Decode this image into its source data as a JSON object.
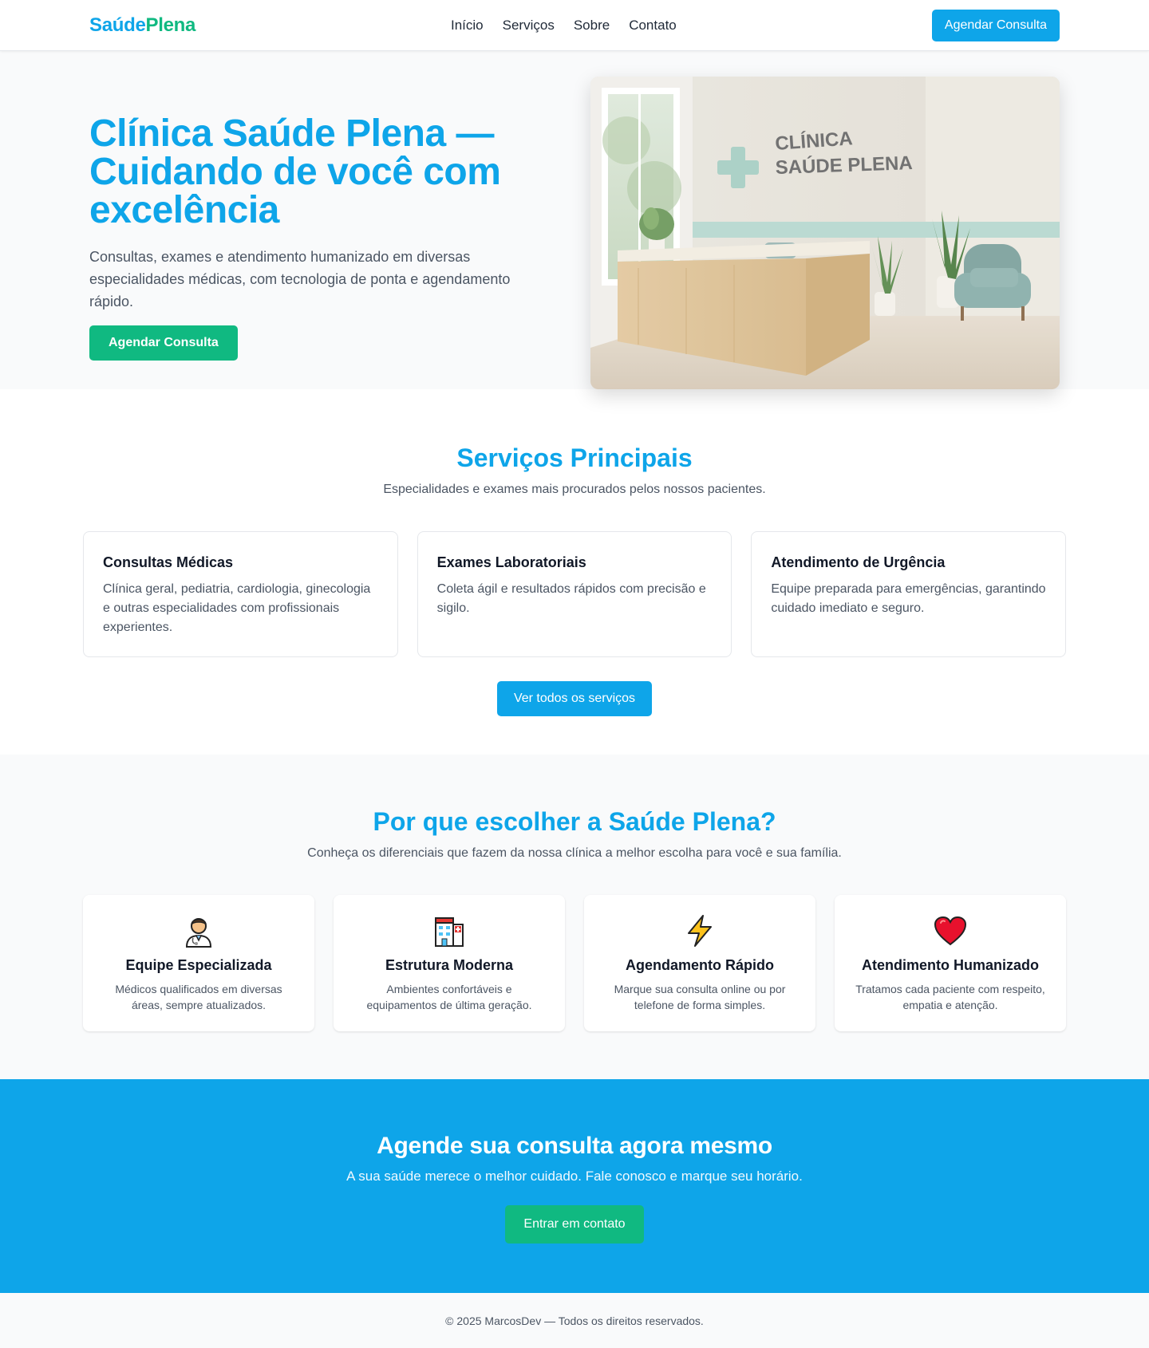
{
  "navbar": {
    "logo_part1": "Saúde",
    "logo_part2": "Plena",
    "links": [
      "Início",
      "Serviços",
      "Sobre",
      "Contato"
    ],
    "cta_label": "Agendar Consulta"
  },
  "hero": {
    "title": "Clínica Saúde Plena — Cuidando de você com excelência",
    "subtitle": "Consultas, exames e atendimento humanizado em diversas especialidades médicas, com tecnologia de ponta e agendamento rápido.",
    "cta_label": "Agendar Consulta",
    "image_sign_line1": "CLÍNICA",
    "image_sign_line2": "SAÚDE PLENA"
  },
  "services": {
    "title": "Serviços Principais",
    "subtitle": "Especialidades e exames mais procurados pelos nossos pacientes.",
    "cards": [
      {
        "title": "Consultas Médicas",
        "text": "Clínica geral, pediatria, cardiologia, ginecologia e outras especialidades com profissionais experientes."
      },
      {
        "title": "Exames Laboratoriais",
        "text": "Coleta ágil e resultados rápidos com precisão e sigilo."
      },
      {
        "title": "Atendimento de Urgência",
        "text": "Equipe preparada para emergências, garantindo cuidado imediato e seguro."
      }
    ],
    "more_label": "Ver todos os serviços"
  },
  "why": {
    "title": "Por que escolher a Saúde Plena?",
    "subtitle": "Conheça os diferenciais que fazem da nossa clínica a melhor escolha para você e sua família.",
    "cards": [
      {
        "icon": "doctor-icon",
        "title": "Equipe Especializada",
        "text": "Médicos qualificados em diversas áreas, sempre atualizados."
      },
      {
        "icon": "hospital-icon",
        "title": "Estrutura Moderna",
        "text": "Ambientes confortáveis e equipamentos de última geração."
      },
      {
        "icon": "lightning-icon",
        "title": "Agendamento Rápido",
        "text": "Marque sua consulta online ou por telefone de forma simples."
      },
      {
        "icon": "heart-icon",
        "title": "Atendimento Humanizado",
        "text": "Tratamos cada paciente com respeito, empatia e atenção."
      }
    ]
  },
  "cta": {
    "title": "Agende sua consulta agora mesmo",
    "subtitle": "A sua saúde merece o melhor cuidado. Fale conosco e marque seu horário.",
    "button_label": "Entrar em contato"
  },
  "footer": {
    "text": "© 2025 MarcosDev — Todos os direitos reservados."
  },
  "colors": {
    "primary": "#0ea5e9",
    "secondary": "#10b981",
    "text": "#1f2937",
    "muted": "#4b5563",
    "section_bg": "#f9fafb"
  }
}
